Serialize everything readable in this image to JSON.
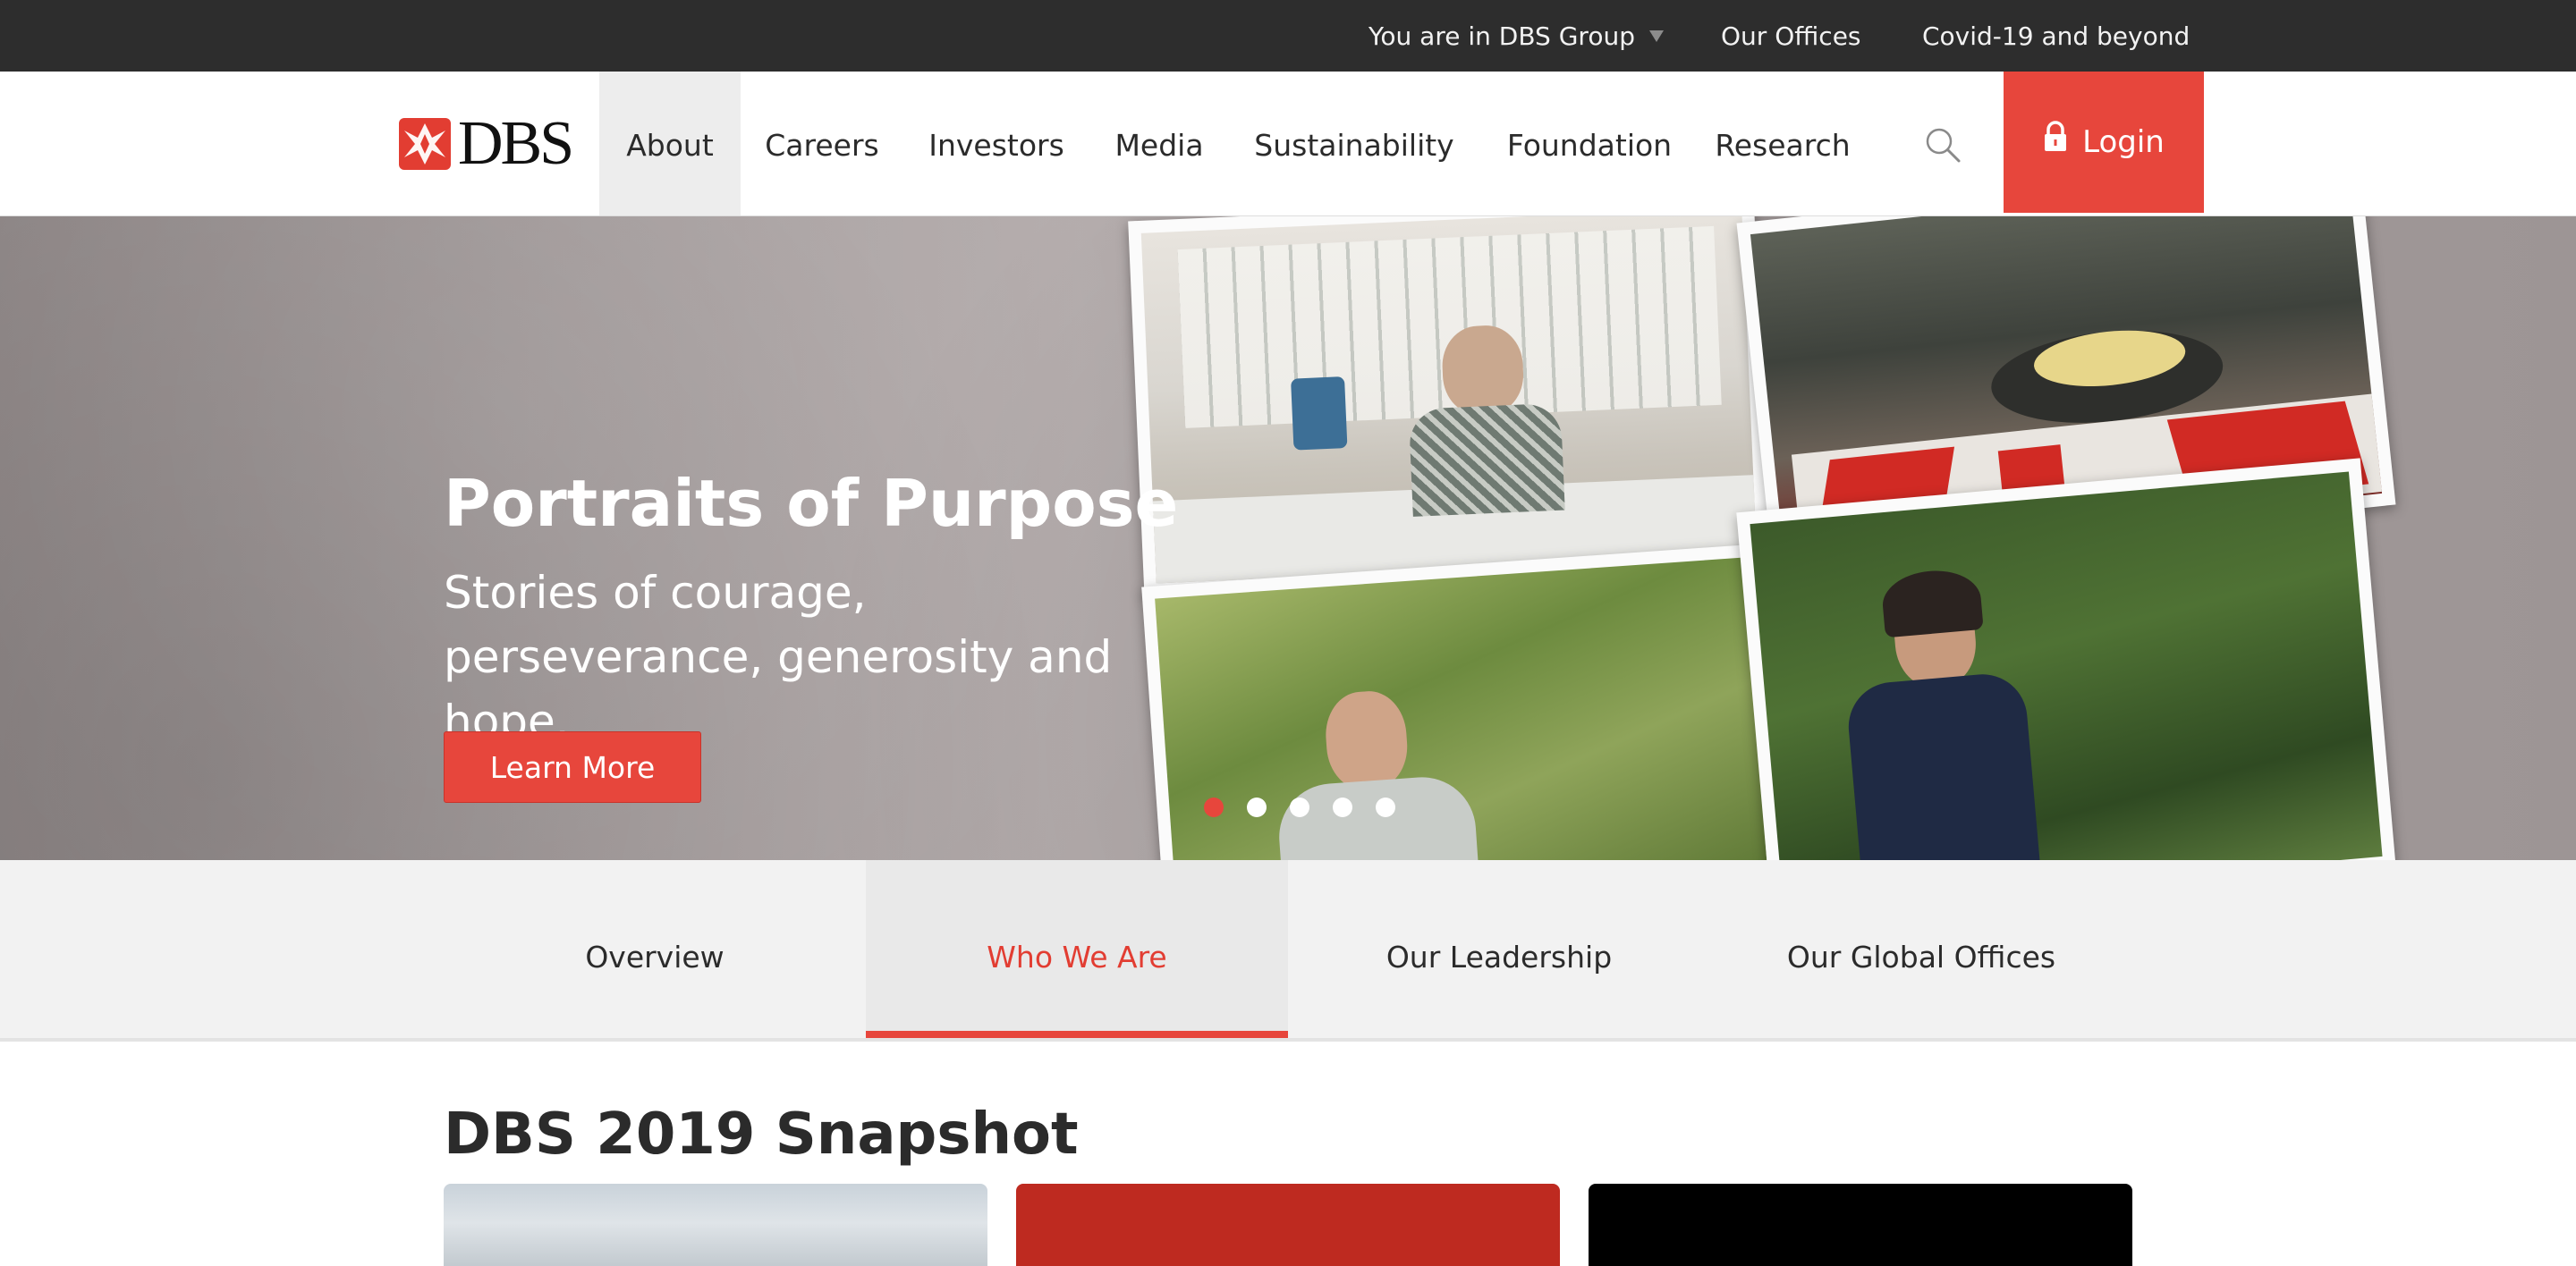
{
  "topbar": {
    "group_label": "You are in DBS Group",
    "offices_link": "Our Offices",
    "covid_link": "Covid-19 and beyond"
  },
  "brand": {
    "name": "DBS",
    "accent_color": "#e7463c",
    "dark_color": "#2d2d2d"
  },
  "nav": {
    "items": [
      {
        "label": "About"
      },
      {
        "label": "Careers"
      },
      {
        "label": "Investors"
      },
      {
        "label": "Media"
      },
      {
        "label": "Sustainability"
      },
      {
        "label": "Foundation"
      },
      {
        "label": "Research"
      }
    ],
    "active": "About",
    "search_icon": "search-icon",
    "login_label": "Login",
    "login_icon": "lock-icon"
  },
  "hero": {
    "title": "Portraits of Purpose",
    "subtitle": "Stories of courage, perseverance, generosity and hope.",
    "button_label": "Learn More",
    "slide_count": 5,
    "active_slide": 1
  },
  "subnav": {
    "tabs": [
      {
        "label": "Overview"
      },
      {
        "label": "Who We Are"
      },
      {
        "label": "Our Leadership"
      },
      {
        "label": "Our Global Offices"
      }
    ],
    "active": "Who We Are"
  },
  "snapshot": {
    "title": "DBS 2019 Snapshot"
  }
}
